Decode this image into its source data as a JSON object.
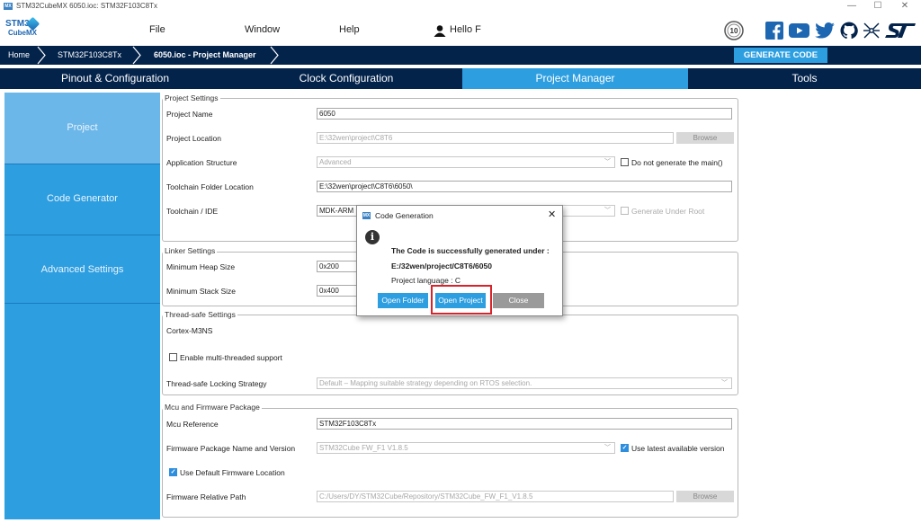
{
  "window": {
    "title": "STM32CubeMX 6050.ioc: STM32F103C8Tx",
    "badge": "MX",
    "minimize": "—",
    "maximize": "☐",
    "close": "✕"
  },
  "menu": {
    "logo_line1": "STM32",
    "logo_line2": "CubeMX",
    "items": [
      "File",
      "Window",
      "Help"
    ],
    "user": "Hello F",
    "social": [
      "10-anniversary",
      "facebook",
      "youtube",
      "twitter",
      "github",
      "network",
      "st-logo"
    ],
    "badge_text": "10"
  },
  "breadcrumb": {
    "items": [
      "Home",
      "STM32F103C8Tx",
      "6050.ioc - Project Manager"
    ],
    "generate_label": "GENERATE CODE"
  },
  "tabs": [
    {
      "label": "Pinout & Configuration",
      "active": false
    },
    {
      "label": "Clock Configuration",
      "active": false
    },
    {
      "label": "Project Manager",
      "active": true
    },
    {
      "label": "Tools",
      "active": false
    }
  ],
  "sidebar": [
    {
      "label": "Project",
      "active": true
    },
    {
      "label": "Code Generator",
      "active": false
    },
    {
      "label": "Advanced Settings",
      "active": false
    }
  ],
  "project_settings": {
    "title": "Project Settings",
    "name_label": "Project Name",
    "name_value": "6050",
    "location_label": "Project Location",
    "location_value": "E:\\32wen\\project\\C8T6",
    "browse": "Browse",
    "app_structure_label": "Application Structure",
    "app_structure_value": "Advanced",
    "no_main_label": "Do not generate the main()",
    "toolchain_folder_label": "Toolchain Folder Location",
    "toolchain_folder_value": "E:\\32wen\\project\\C8T6\\6050\\",
    "toolchain_ide_label": "Toolchain / IDE",
    "toolchain_ide_value": "MDK-ARM",
    "generate_under_root": "Generate Under Root"
  },
  "linker_settings": {
    "title": "Linker Settings",
    "heap_label": "Minimum Heap Size",
    "heap_value": "0x200",
    "stack_label": "Minimum Stack Size",
    "stack_value": "0x400"
  },
  "thread_safe": {
    "title": "Thread-safe Settings",
    "core": "Cortex-M3NS",
    "enable_label": "Enable multi-threaded support",
    "strategy_label": "Thread-safe Locking Strategy",
    "strategy_value": "Default  –  Mapping suitable strategy depending on RTOS selection."
  },
  "mcu_firmware": {
    "title": "Mcu and Firmware Package",
    "mcu_ref_label": "Mcu Reference",
    "mcu_ref_value": "STM32F103C8Tx",
    "fw_label": "Firmware Package Name and Version",
    "fw_value": "STM32Cube FW_F1 V1.8.5",
    "latest_label": "Use latest available version",
    "default_loc_label": "Use Default Firmware Location",
    "rel_path_label": "Firmware Relative Path",
    "rel_path_value": "C:/Users/DY/STM32Cube/Repository/STM32Cube_FW_F1_V1.8.5",
    "browse": "Browse"
  },
  "dialog": {
    "badge": "MX",
    "title": "Code Generation",
    "close": "✕",
    "info": "i",
    "line1": "The Code is successfully generated under :",
    "line2": "E:/32wen/project/C8T6/6050",
    "line3": "Project language : C",
    "open_folder": "Open Folder",
    "open_project": "Open Project",
    "close_btn": "Close"
  },
  "colors": {
    "navy": "#03234b",
    "accent": "#2d9ee0",
    "sidebar_active": "#6cb7e9",
    "highlight": "#d9232a"
  }
}
